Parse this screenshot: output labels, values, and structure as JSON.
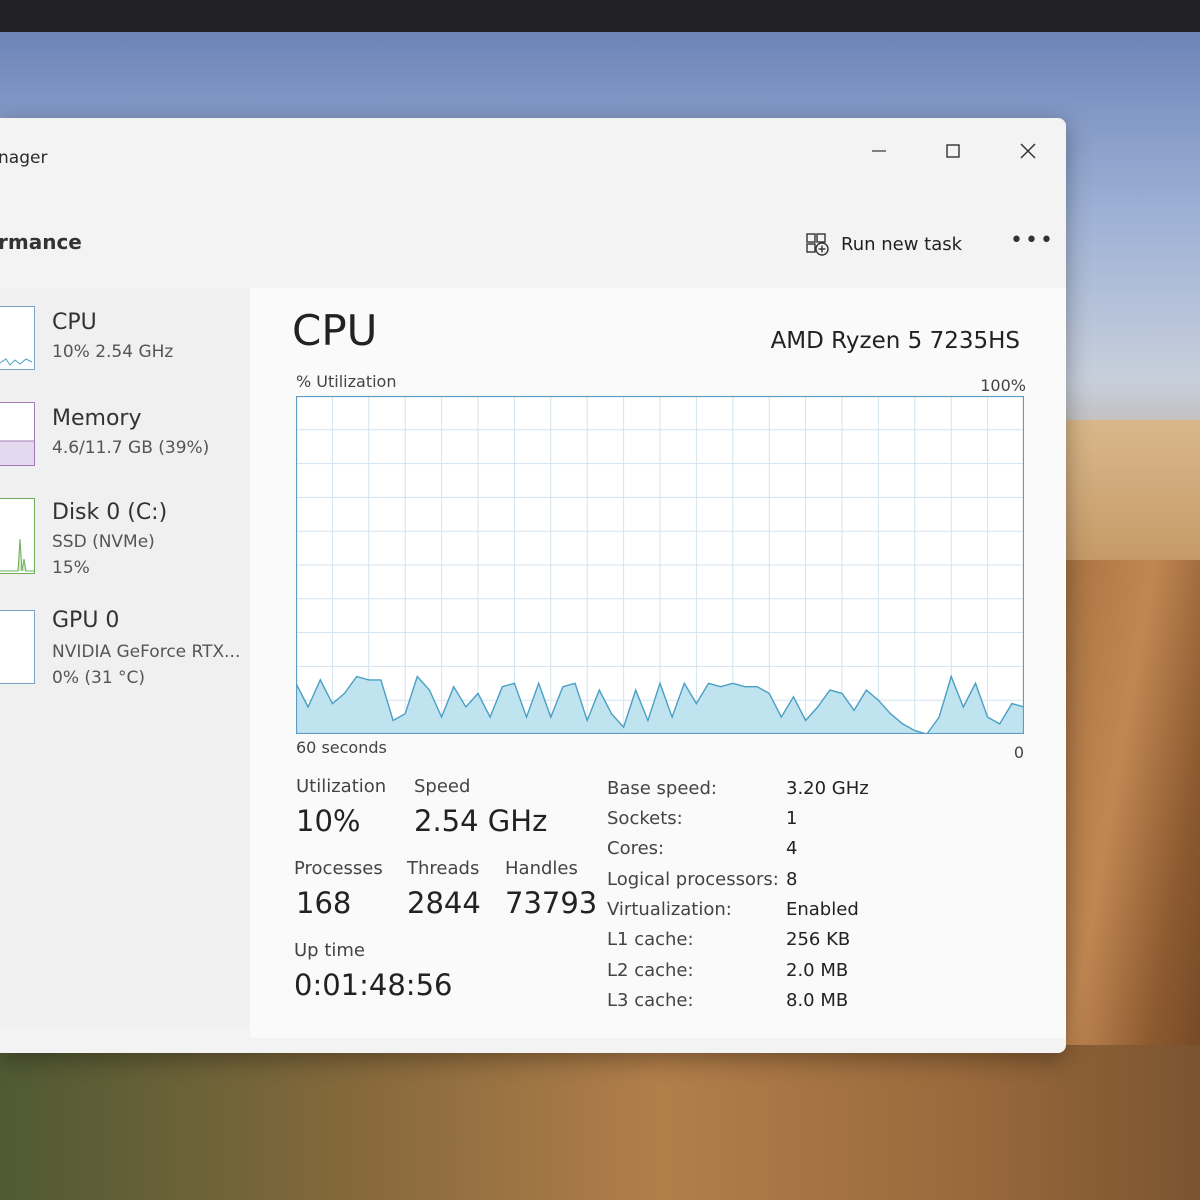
{
  "window": {
    "title": "nager",
    "minimize_icon": "minimize-icon",
    "maximize_icon": "maximize-icon",
    "close_icon": "close-icon"
  },
  "header": {
    "title": "rmance",
    "run_task_label": "Run new task",
    "run_task_icon": "run-task-icon",
    "more_icon": "more-options-icon"
  },
  "sidebar": {
    "items": [
      {
        "title": "CPU",
        "sub1": "10%  2.54 GHz",
        "sub2": ""
      },
      {
        "title": "Memory",
        "sub1": "4.6/11.7 GB (39%)",
        "sub2": ""
      },
      {
        "title": "Disk 0 (C:)",
        "sub1": "SSD (NVMe)",
        "sub2": "15%"
      },
      {
        "title": "GPU 0",
        "sub1": "NVIDIA GeForce RTX...",
        "sub2": "0%  (31 °C)"
      }
    ]
  },
  "main": {
    "title": "CPU",
    "model": "AMD Ryzen 5 7235HS",
    "util_label": "% Utilization",
    "max_label": "100%",
    "time_label": "60 seconds",
    "zero_label": "0",
    "stats": {
      "utilization_label": "Utilization",
      "utilization_value": "10%",
      "speed_label": "Speed",
      "speed_value": "2.54 GHz",
      "processes_label": "Processes",
      "processes_value": "168",
      "threads_label": "Threads",
      "threads_value": "2844",
      "handles_label": "Handles",
      "handles_value": "73793",
      "uptime_label": "Up time",
      "uptime_value": "0:01:48:56"
    },
    "specs": [
      {
        "label": "Base speed:",
        "value": "3.20 GHz"
      },
      {
        "label": "Sockets:",
        "value": "1"
      },
      {
        "label": "Cores:",
        "value": "4"
      },
      {
        "label": "Logical processors:",
        "value": "8"
      },
      {
        "label": "Virtualization:",
        "value": "Enabled"
      },
      {
        "label": "L1 cache:",
        "value": "256 KB"
      },
      {
        "label": "L2 cache:",
        "value": "2.0 MB"
      },
      {
        "label": "L3 cache:",
        "value": "8.0 MB"
      }
    ]
  },
  "colors": {
    "graph_line": "#4a9fc4",
    "graph_fill": "#bfe3ef",
    "graph_grid": "#d3e3ef",
    "graph_border": "#5d9ac6"
  },
  "chart_data": {
    "type": "area",
    "x": [
      0,
      1,
      2,
      3,
      4,
      5,
      6,
      7,
      8,
      9,
      10,
      11,
      12,
      13,
      14,
      15,
      16,
      17,
      18,
      19,
      20,
      21,
      22,
      23,
      24,
      25,
      26,
      27,
      28,
      29,
      30,
      31,
      32,
      33,
      34,
      35,
      36,
      37,
      38,
      39,
      40,
      41,
      42,
      43,
      44,
      45,
      46,
      47,
      48,
      49,
      50,
      51,
      52,
      53,
      54,
      55,
      56,
      57,
      58,
      59,
      60
    ],
    "values": [
      15,
      8,
      16,
      9,
      12,
      17,
      16,
      16,
      4,
      6,
      17,
      13,
      5,
      14,
      8,
      12,
      5,
      14,
      15,
      5,
      15,
      5,
      14,
      15,
      4,
      13,
      6,
      2,
      13,
      4,
      15,
      5,
      15,
      9,
      15,
      14,
      15,
      14,
      14,
      12,
      5,
      11,
      4,
      8,
      13,
      12,
      7,
      13,
      10,
      6,
      3,
      1,
      0,
      5,
      17,
      8,
      15,
      5,
      3,
      9,
      8
    ],
    "xlabel": "60 seconds",
    "ylabel": "% Utilization",
    "ylim": [
      0,
      100
    ]
  }
}
